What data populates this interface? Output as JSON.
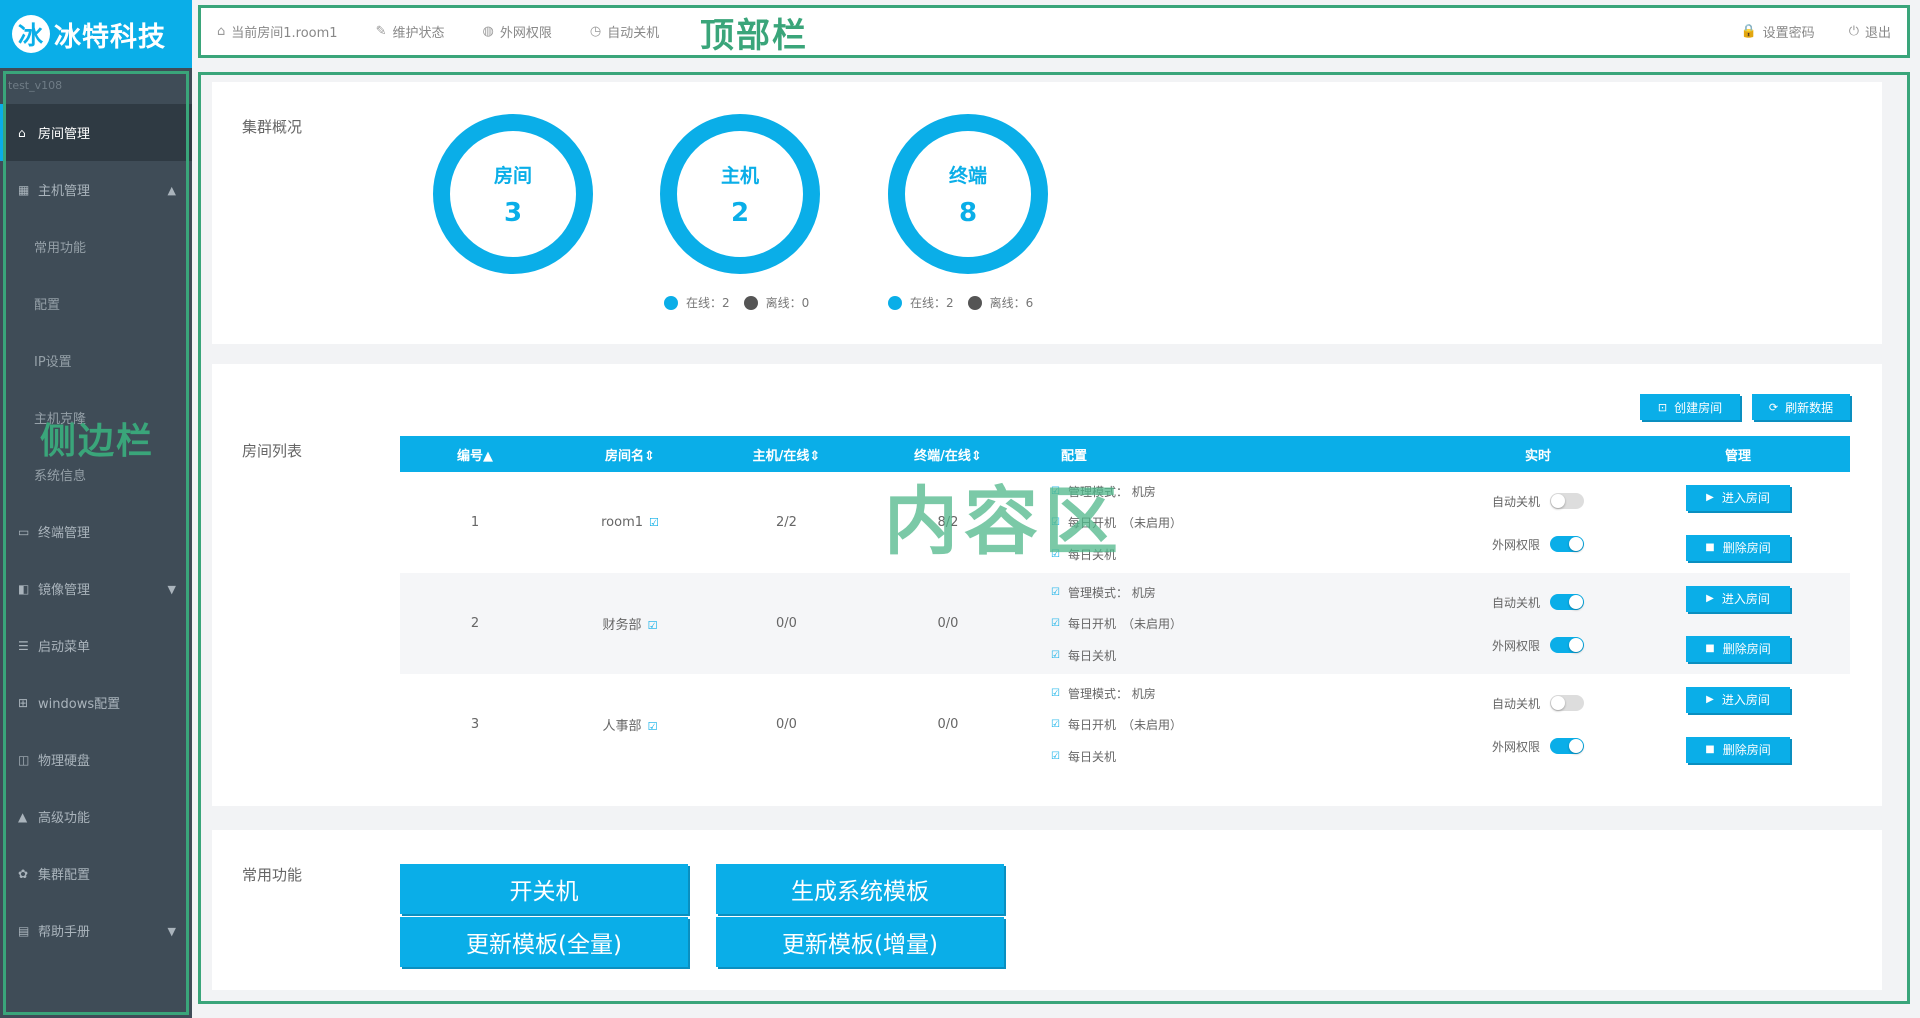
{
  "logo": {
    "mark": "冰",
    "text": "冰特科技"
  },
  "topbar": {
    "items": [
      {
        "icon": "⌂",
        "label": "当前房间1.room1"
      },
      {
        "icon": "✎",
        "label": "维护状态"
      },
      {
        "icon": "◍",
        "label": "外网权限"
      },
      {
        "icon": "◷",
        "label": "自动关机"
      }
    ],
    "right": [
      {
        "icon": "🔒",
        "label": "设置密码"
      },
      {
        "icon": "⏻",
        "label": "退出"
      }
    ],
    "annotation": "顶部栏"
  },
  "sidebar": {
    "user": "test_v108",
    "items": [
      {
        "label": "房间管理",
        "icon": "⌂"
      },
      {
        "label": "主机管理",
        "icon": "▦"
      },
      {
        "label": "常用功能"
      },
      {
        "label": "配置"
      },
      {
        "label": "IP设置"
      },
      {
        "label": "主机克隆"
      },
      {
        "label": "系统信息"
      },
      {
        "label": "终端管理",
        "icon": "▭"
      },
      {
        "label": "镜像管理",
        "icon": "◧"
      },
      {
        "label": "启动菜单",
        "icon": "☰"
      },
      {
        "label": "windows配置",
        "icon": "⊞"
      },
      {
        "label": "物理硬盘",
        "icon": "◫"
      },
      {
        "label": "高级功能",
        "icon": "▲"
      },
      {
        "label": "集群配置",
        "icon": "✿"
      },
      {
        "label": "帮助手册",
        "icon": "▤"
      }
    ],
    "annotation": "侧边栏"
  },
  "overview": {
    "label": "集群概况",
    "rings": [
      {
        "label": "房间",
        "value": "3"
      },
      {
        "label": "主机",
        "value": "2"
      },
      {
        "label": "终端",
        "value": "8"
      }
    ],
    "host_status": {
      "online": "在线：2",
      "offline": "离线：0"
    },
    "terminal_status": {
      "online": "在线：2",
      "offline": "离线：6"
    }
  },
  "room_list": {
    "label": "房间列表",
    "create_button": "创建房间",
    "refresh_button": "刷新数据",
    "columns": [
      "编号▲",
      "房间名⇕",
      "主机/在线⇕",
      "终端/在线⇕",
      "配置",
      "实时",
      "管理"
    ],
    "rows": [
      {
        "id": "1",
        "name": "room1",
        "hosts": "2/2",
        "terminals": "8/2",
        "mode": "管理模式： 机房",
        "boot": "每日开机　（未启用）",
        "shutdown": "每日关机",
        "auto_off_label": "自动关机",
        "net_label": "外网权限",
        "auto_off": false,
        "net": true,
        "enter": "进入房间",
        "delete": "删除房间"
      },
      {
        "id": "2",
        "name": "财务部",
        "hosts": "0/0",
        "terminals": "0/0",
        "mode": "管理模式： 机房",
        "boot": "每日开机　（未启用）",
        "shutdown": "每日关机",
        "auto_off_label": "自动关机",
        "net_label": "外网权限",
        "auto_off": true,
        "net": true,
        "enter": "进入房间",
        "delete": "删除房间"
      },
      {
        "id": "3",
        "name": "人事部",
        "hosts": "0/0",
        "terminals": "0/0",
        "mode": "管理模式： 机房",
        "boot": "每日开机　（未启用）",
        "shutdown": "每日关机",
        "auto_off_label": "自动关机",
        "net_label": "外网权限",
        "auto_off": false,
        "net": true,
        "enter": "进入房间",
        "delete": "删除房间"
      }
    ]
  },
  "content_annotation": "内容区",
  "functions": {
    "label": "常用功能",
    "buttons": [
      "开关机",
      "生成系统模板",
      "更新模板(全量)",
      "更新模板(增量)"
    ]
  },
  "colors": {
    "accent": "#0aaee8",
    "sidebar": "#3f4c57",
    "annotation": "#3aa57a"
  }
}
